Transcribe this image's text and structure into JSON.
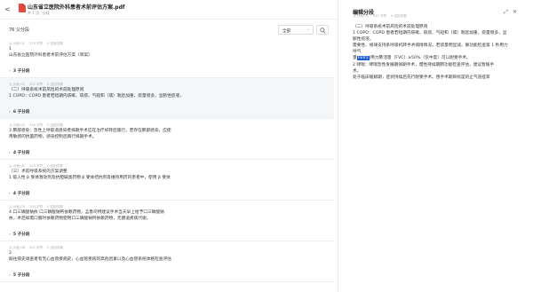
{
  "header": {
    "back_label": "<",
    "file_title": "山东省立医院外科患者术前评估方案.pdf",
    "file_meta": "共 1 页 · 分段"
  },
  "list": {
    "count_label": "76 父分段",
    "filter_value": "全部",
    "segments": [
      {
        "id": "父-分段-01",
        "chars": "275 字符",
        "hits": "0 召回次数",
        "lines": [
          "1",
          "山东省立医院外科患者术前评估方案（草案）"
        ],
        "children": "3 子分段",
        "active": false
      },
      {
        "id": "父-分段-02",
        "chars": "222 字符",
        "hits": "0 召回次数",
        "lines": [
          "（二）呼吸系统术前风险的术前处理原则",
          "1 COPD：COPD 患者若短期内咳嗽、咳痰、气短和（或）喘息加重，痰量增多，呈脓性痰液，"
        ],
        "children": "6 子分段",
        "active": true
      },
      {
        "id": "父-分段-03",
        "chars": "216 字符",
        "hits": "0 召回次数",
        "lines": [
          "3 肺部感染：急性上呼吸道感染者择期手术应在治疗好转后施行，若存在肺部感染，应使",
          "用敏感的抗菌药物，感染控制后再行择期手术。"
        ],
        "children": "4 子分段",
        "active": false
      },
      {
        "id": "父-分段-04",
        "chars": "225 字符",
        "hits": "0 召回次数",
        "lines": [
          "（三）术前呼吸系统的方案调整",
          "1 吸入性 β 受体激动剂及抗胆碱类药物 β 受体拮抗剂等维持用药的患者中，使用 β 受体"
        ],
        "children": "4 子分段",
        "active": false
      },
      {
        "id": "父-分段-05",
        "chars": "105 字符",
        "hits": "0 召回次数",
        "lines": [
          "4 口三磷酸钠依 口三磷酸钠钙依赖药物，孟鲁司特建议手术当天早上给予口三磷酸钠",
          "依，术后如需口服时依赖药物使用口三磷酸钠钙依赖药物，无肠道疾病代谢。"
        ],
        "children": "5 子分段",
        "active": false
      },
      {
        "id": "父-分段-06",
        "chars": "222 字符",
        "hits": "0 召回次数",
        "lines": [
          "2",
          "既往病史调查者有无心血管疾病史，心血管疾病的高危因素以及心血管系统体格检查评估"
        ],
        "children": "5 子分段",
        "active": false
      }
    ]
  },
  "detail": {
    "title": "编辑分段",
    "id": "父-分段-02",
    "chars": "222 字符",
    "hits": "0 召回次数",
    "lines": [
      "（二）呼吸系统术前风险的术前处理原则",
      "1 COPD：COPD 患者若短期内咳嗽、咳痰、气短和（或）喘息加重，痰量增多，呈",
      "脓性痰液，",
      "需要性、规律支持系呼吸机转手术病情情况。若痰量明显减，静功能检查第 1 秒用力",
      "呼气"
    ],
    "hl_pre": "量",
    "hl_text": "FEV1",
    "hl_post": "/用力肺活量（FVC）≥50%（仅中度）可以耐受手术。",
    "tail": [
      "2 哮喘：哮喘急性发展期择期手术，慢性持续期肺功能检查评估，建议暂缓手",
      "术。",
      "处于临床缓解期，症状持续后先行耐受手术。围手术期目标是的止气道痉挛"
    ]
  }
}
